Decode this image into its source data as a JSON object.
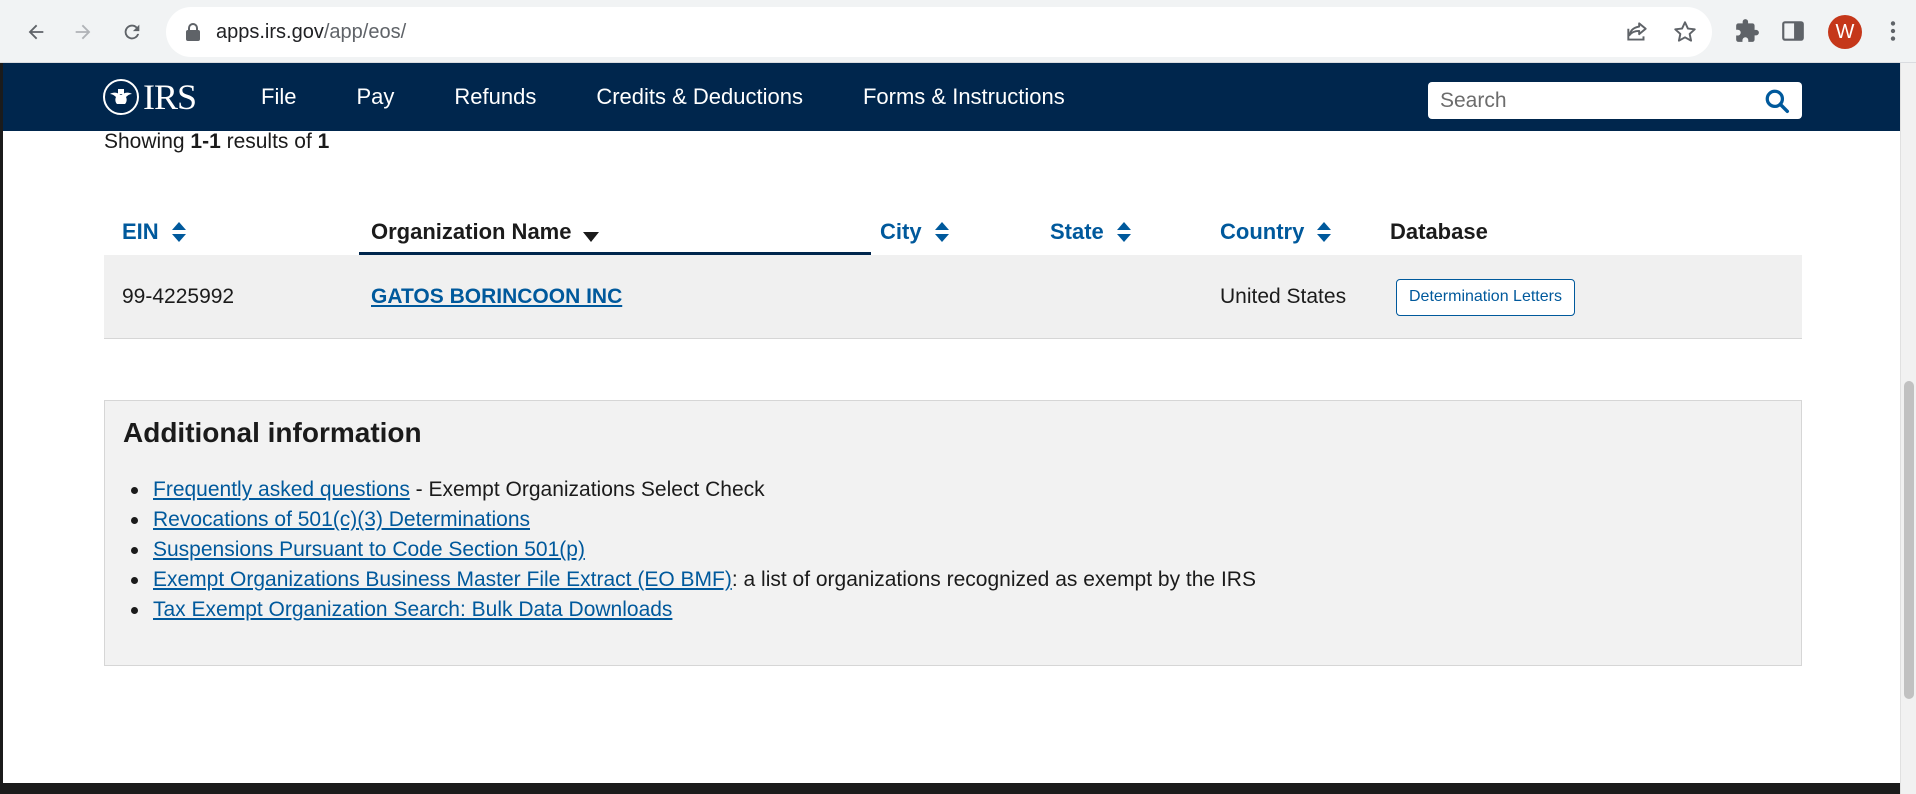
{
  "browser": {
    "url_host": "apps.irs.gov",
    "url_path": "/app/eos/",
    "profile_initial": "W",
    "profile_color": "#c5371a"
  },
  "header": {
    "logo_text": "IRS",
    "nav": [
      "File",
      "Pay",
      "Refunds",
      "Credits & Deductions",
      "Forms & Instructions"
    ],
    "search_placeholder": "Search",
    "bg_color": "#00264d"
  },
  "results": {
    "showing_prefix": "Showing ",
    "showing_range": "1-1",
    "showing_mid": " results of ",
    "showing_total": "1"
  },
  "table": {
    "columns": {
      "ein": "EIN",
      "org_name": "Organization Name",
      "city": "City",
      "state": "State",
      "country": "Country",
      "database": "Database"
    },
    "rows": [
      {
        "ein": "99-4225992",
        "org_name": "GATOS BORINCOON INC",
        "city": "",
        "state": "",
        "country": "United States",
        "database_button": "Determination Letters"
      }
    ]
  },
  "additional_info": {
    "title": "Additional information",
    "items": [
      {
        "link": "Frequently asked questions",
        "suffix": " - Exempt Organizations Select Check"
      },
      {
        "link": "Revocations of 501(c)(3) Determinations",
        "suffix": ""
      },
      {
        "link": "Suspensions Pursuant to Code Section 501(p)",
        "suffix": ""
      },
      {
        "link": "Exempt Organizations Business Master File Extract (EO BMF)",
        "suffix": ": a list of organizations recognized as exempt by the IRS"
      },
      {
        "link": "Tax Exempt Organization Search: Bulk Data Downloads",
        "suffix": ""
      }
    ]
  },
  "colors": {
    "link": "#00599c",
    "accent": "#00264d"
  }
}
